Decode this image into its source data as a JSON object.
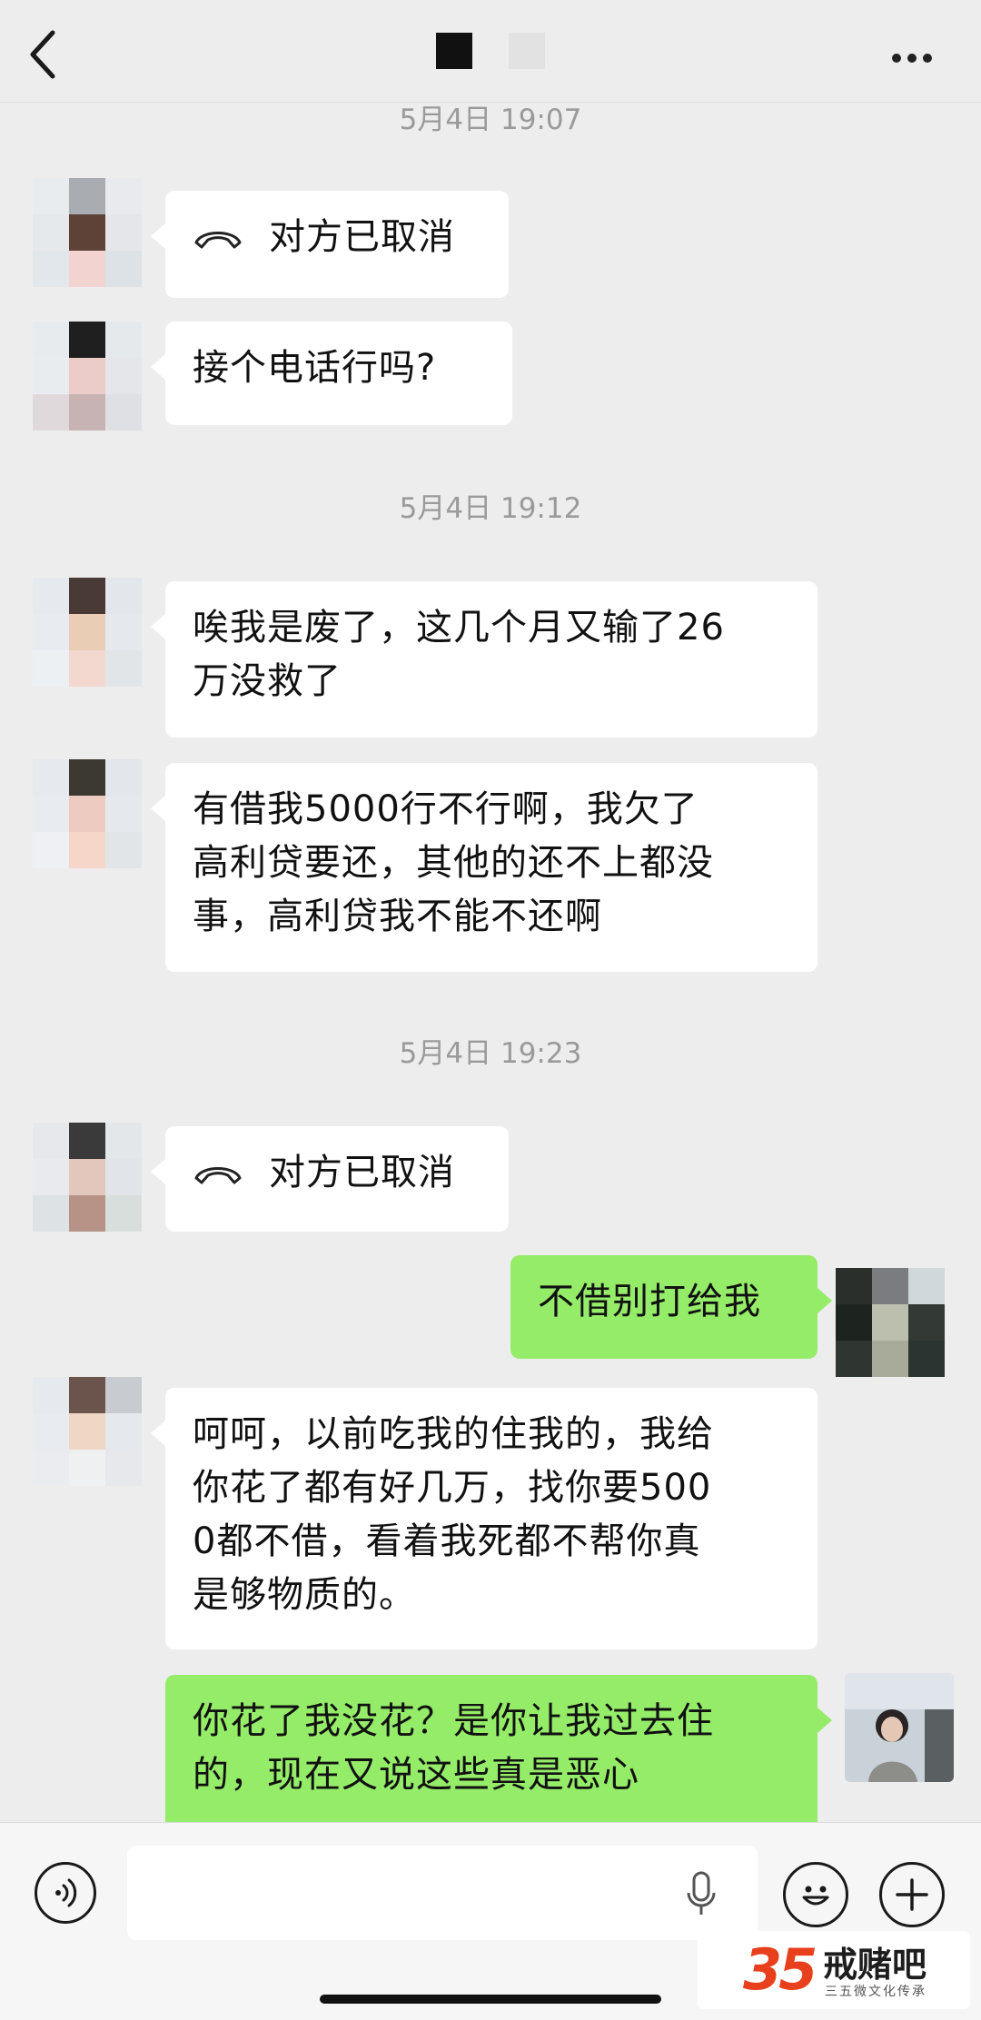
{
  "header": {
    "back": "back",
    "more": "more-options"
  },
  "timestamps": [
    "5月4日 19:07",
    "5月4日 19:12",
    "5月4日 19:23"
  ],
  "messages": [
    {
      "side": "in",
      "type": "call",
      "text": "对方已取消"
    },
    {
      "side": "in",
      "type": "text",
      "lines": [
        "接个电话行吗?"
      ]
    },
    {
      "side": "in",
      "type": "text",
      "lines": [
        "唉我是废了，这几个月又输了26",
        "万没救了"
      ]
    },
    {
      "side": "in",
      "type": "text",
      "lines": [
        "有借我5000行不行啊，我欠了",
        "高利贷要还，其他的还不上都没",
        "事，高利贷我不能不还啊"
      ]
    },
    {
      "side": "in",
      "type": "call",
      "text": "对方已取消"
    },
    {
      "side": "out",
      "type": "text",
      "lines": [
        "不借别打给我"
      ]
    },
    {
      "side": "in",
      "type": "text",
      "lines": [
        "呵呵，以前吃我的住我的，我给",
        "你花了都有好几万，找你要500",
        "0都不借，看着我死都不帮你真",
        "是够物质的。"
      ]
    },
    {
      "side": "out",
      "type": "text",
      "lines": [
        "你花了我没花？是你让我过去住",
        "的，现在又说这些真是恶心"
      ]
    }
  ],
  "input": {
    "placeholder": "",
    "icons": [
      "voice-icon",
      "microphone-icon",
      "emoji-icon",
      "plus-icon"
    ]
  },
  "watermark": {
    "number": "35",
    "name": "戒赌吧",
    "subtitle": "三五微文化传承"
  },
  "colors": {
    "background": "#ededed",
    "incoming_bubble": "#ffffff",
    "outgoing_bubble": "#95ec69",
    "timestamp": "#9a9a9a"
  }
}
